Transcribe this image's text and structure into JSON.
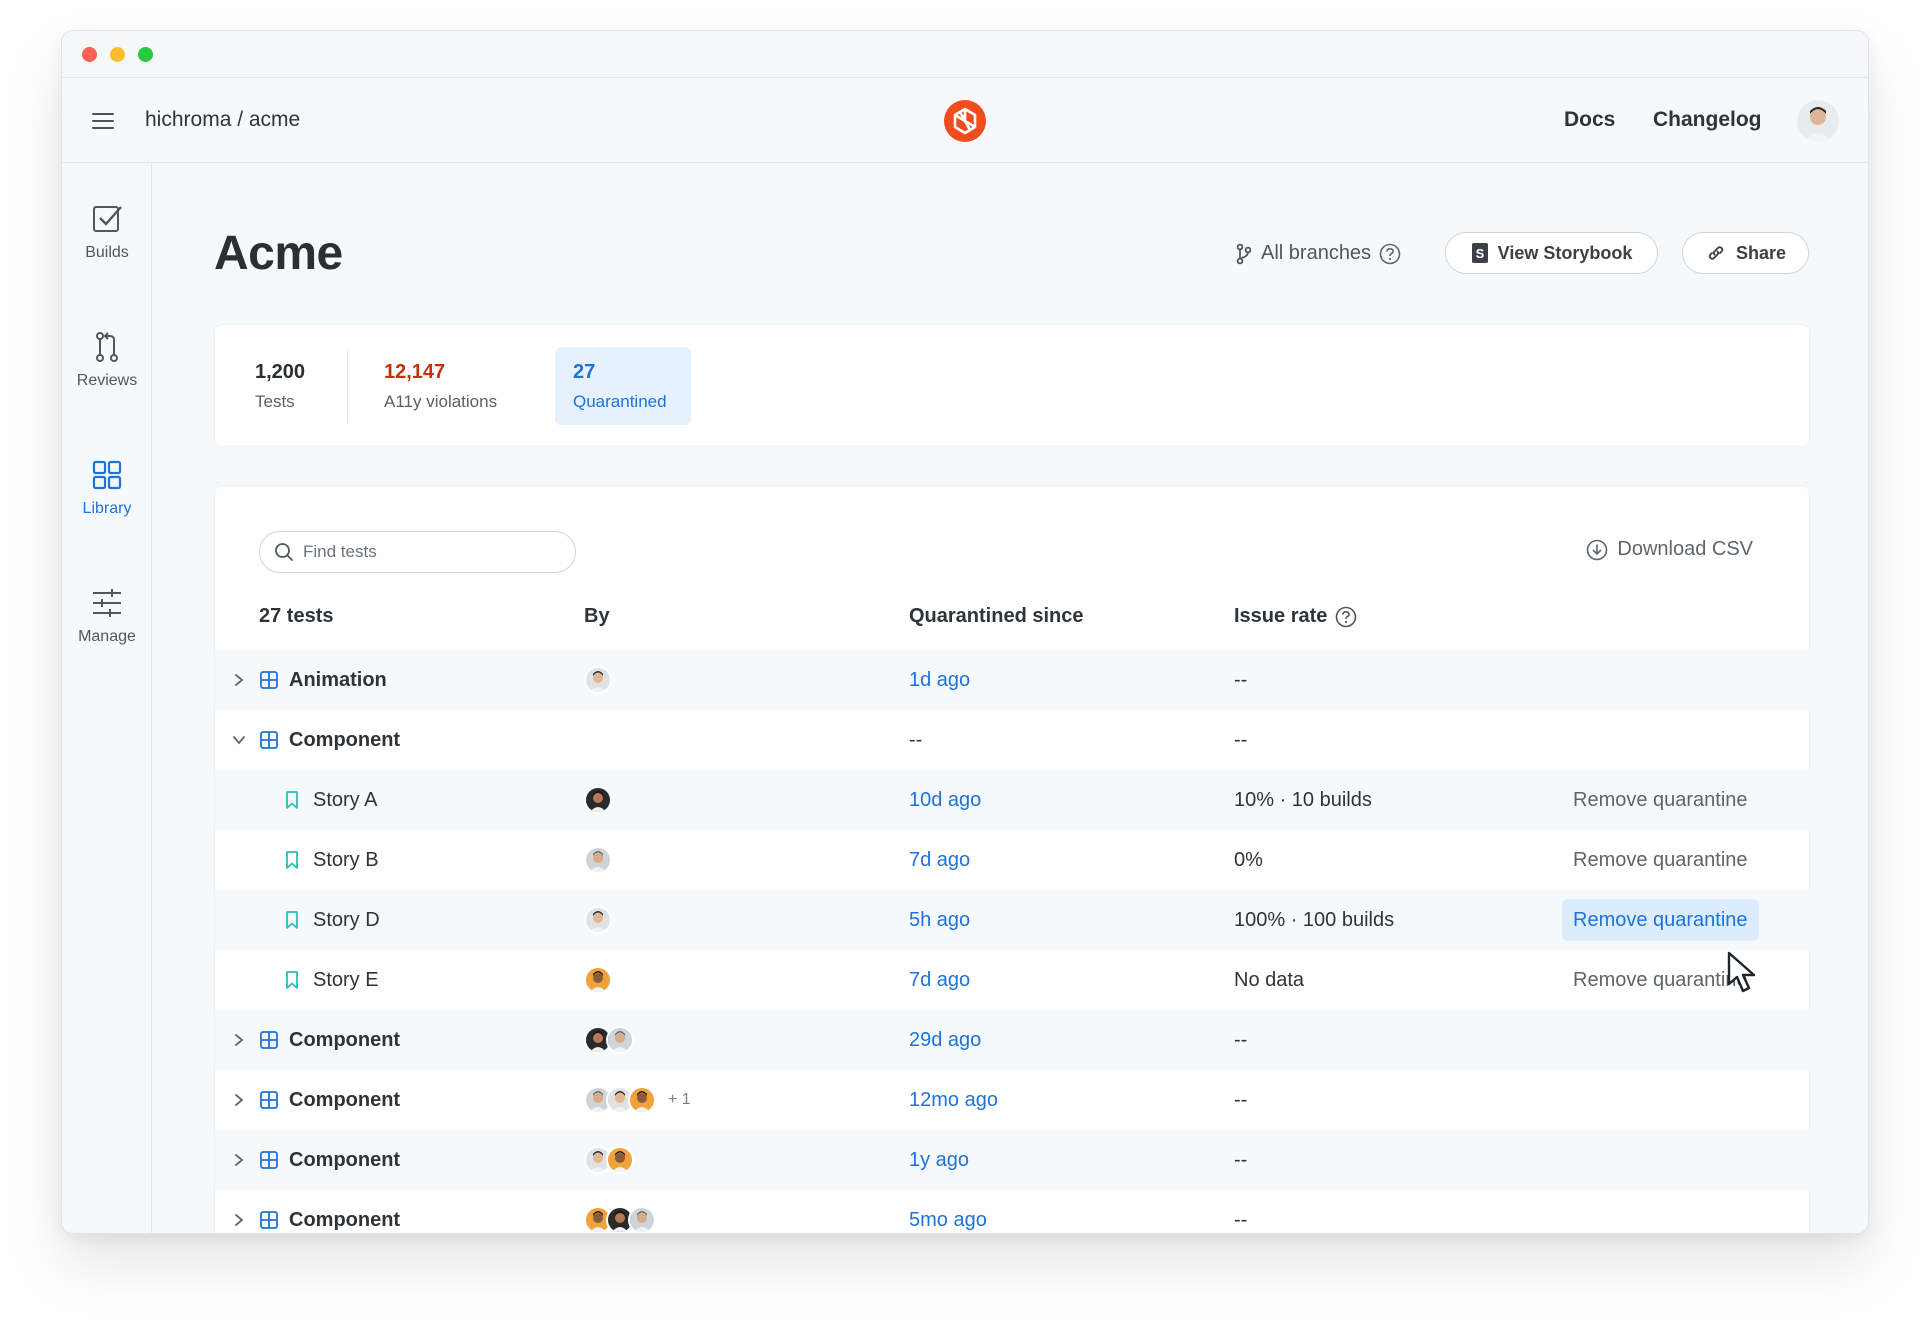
{
  "window": {
    "title": "hichroma / acme"
  },
  "header": {
    "breadcrumb": "hichroma / acme",
    "docs": "Docs",
    "changelog": "Changelog",
    "accent": "#f04d1f"
  },
  "sidebar": {
    "items": [
      {
        "label": "Builds",
        "icon": "checkbox-icon",
        "active": false
      },
      {
        "label": "Reviews",
        "icon": "pull-request-icon",
        "active": false
      },
      {
        "label": "Library",
        "icon": "grid-icon",
        "active": true
      },
      {
        "label": "Manage",
        "icon": "sliders-icon",
        "active": false
      }
    ]
  },
  "page": {
    "title": "Acme",
    "branch": "All branches",
    "view_storybook": "View Storybook",
    "share": "Share"
  },
  "stats": [
    {
      "value": "1,200",
      "label": "Tests"
    },
    {
      "value": "12,147",
      "label": "A11y violations"
    },
    {
      "value": "27",
      "label": "Quarantined"
    }
  ],
  "table": {
    "search_placeholder": "Find tests",
    "download": "Download CSV",
    "headers": {
      "name": "27 tests",
      "by": "By",
      "since": "Quarantined since",
      "rate": "Issue rate"
    },
    "rows": [
      {
        "kind": "group",
        "expanded": false,
        "name": "Animation",
        "avatars": 1,
        "extra": "",
        "since": "1d ago",
        "rate": "--",
        "action": ""
      },
      {
        "kind": "group",
        "expanded": true,
        "name": "Component",
        "avatars": 0,
        "extra": "",
        "since": "--",
        "rate": "--",
        "action": ""
      },
      {
        "kind": "story",
        "name": "Story A",
        "avatars": 1,
        "extra": "",
        "since": "10d ago",
        "rate": "10% · 10 builds",
        "action": "Remove quarantine"
      },
      {
        "kind": "story",
        "name": "Story B",
        "avatars": 1,
        "extra": "",
        "since": "7d ago",
        "rate": "0%",
        "action": "Remove quarantine"
      },
      {
        "kind": "story",
        "name": "Story D",
        "avatars": 1,
        "extra": "",
        "since": "5h ago",
        "rate": "100% · 100 builds",
        "action": "Remove quarantine",
        "hover": true
      },
      {
        "kind": "story",
        "name": "Story E",
        "avatars": 1,
        "extra": "",
        "since": "7d ago",
        "rate": "No data",
        "action": "Remove quarantine"
      },
      {
        "kind": "group",
        "expanded": false,
        "name": "Component",
        "avatars": 2,
        "extra": "",
        "since": "29d ago",
        "rate": "--",
        "action": ""
      },
      {
        "kind": "group",
        "expanded": false,
        "name": "Component",
        "avatars": 3,
        "extra": "+ 1",
        "since": "12mo ago",
        "rate": "--",
        "action": ""
      },
      {
        "kind": "group",
        "expanded": false,
        "name": "Component",
        "avatars": 2,
        "extra": "",
        "since": "1y ago",
        "rate": "--",
        "action": ""
      },
      {
        "kind": "group",
        "expanded": false,
        "name": "Component",
        "avatars": 3,
        "extra": "",
        "since": "5mo ago",
        "rate": "--",
        "action": ""
      }
    ]
  },
  "colors": {
    "link": "#1e73d8",
    "danger": "#c6320a",
    "story_icon": "#2bc1b4"
  }
}
